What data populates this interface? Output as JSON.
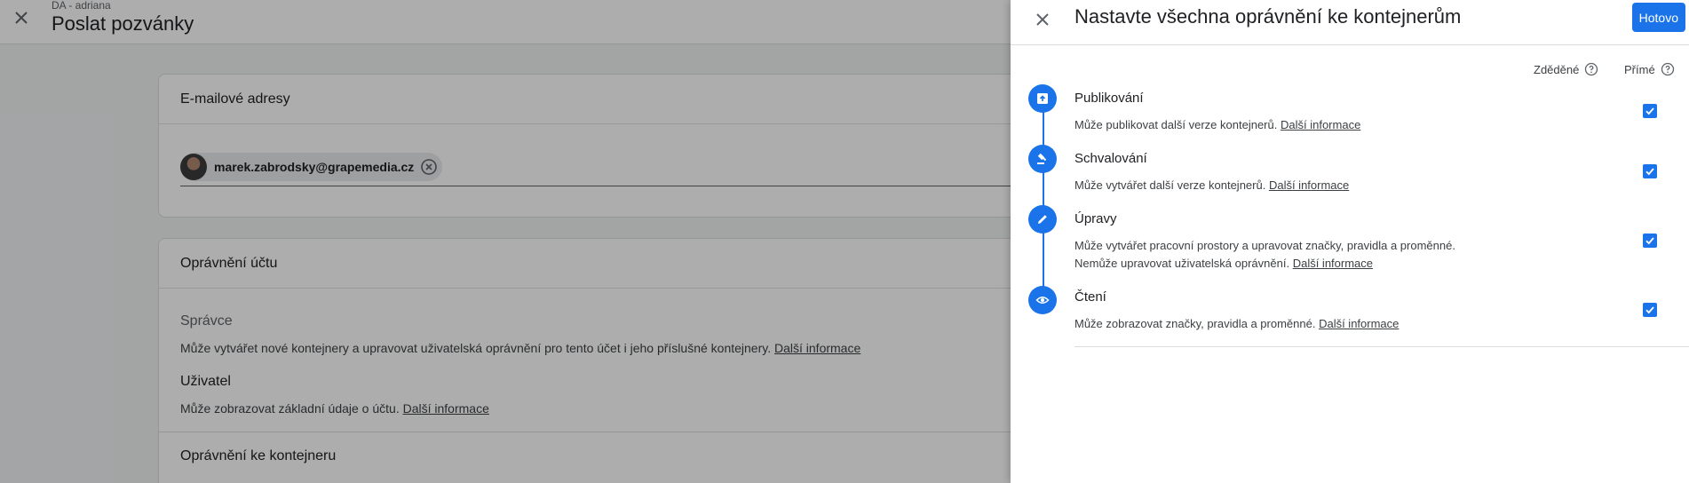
{
  "background": {
    "subtitle": "DA - adriana",
    "title": "Poslat pozvánky",
    "email_card": {
      "header": "E-mailové adresy",
      "chip_email": "marek.zabrodsky@grapemedia.cz"
    },
    "account_card": {
      "header": "Oprávnění účtu",
      "roles": [
        {
          "title": "Správce",
          "desc": "Může vytvářet nové kontejnery a upravovat uživatelská oprávnění pro tento účet i jeho příslušné kontejnery.",
          "link": "Další informace"
        },
        {
          "title": "Uživatel",
          "desc": "Může zobrazovat základní údaje o účtu.",
          "link": "Další informace"
        }
      ],
      "container_header": "Oprávnění ke kontejneru"
    }
  },
  "panel": {
    "title": "Nastavte všechna oprávnění ke kontejnerům",
    "done_label": "Hotovo",
    "columns": {
      "inherited": "Zděděné",
      "direct": "Přímé"
    },
    "permissions": [
      {
        "title": "Publikování",
        "desc": "Může publikovat další verze kontejnerů.",
        "link": "Další informace",
        "icon": "publish-icon",
        "checked": true
      },
      {
        "title": "Schvalování",
        "desc": "Může vytvářet další verze kontejnerů.",
        "link": "Další informace",
        "icon": "gavel-icon",
        "checked": true
      },
      {
        "title": "Úpravy",
        "desc": "Může vytvářet pracovní prostory a upravovat značky, pravidla a proměnné.\nNemůže upravovat uživatelská oprávnění.",
        "link": "Další informace",
        "icon": "pencil-icon",
        "checked": true
      },
      {
        "title": "Čtení",
        "desc": "Může zobrazovat značky, pravidla a proměnné.",
        "link": "Další informace",
        "icon": "eye-icon",
        "checked": true
      }
    ]
  },
  "colors": {
    "accent": "#1a73e8",
    "scrim": "rgba(0,0,0,0.32)"
  }
}
